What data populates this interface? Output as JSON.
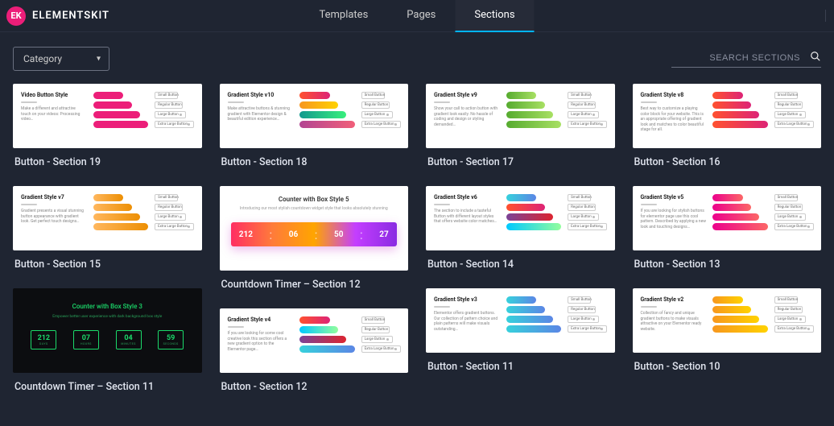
{
  "header": {
    "brand": "ELEMENTSKIT",
    "logo_initials": "EK",
    "tabs": [
      {
        "label": "Templates",
        "active": false
      },
      {
        "label": "Pages",
        "active": false
      },
      {
        "label": "Sections",
        "active": true
      }
    ]
  },
  "subbar": {
    "category_label": "Category",
    "search_placeholder": "SEARCH SECTIONS"
  },
  "cards": [
    {
      "title": "Button - Section 19",
      "ptitle": "Video Button Style",
      "psub": "Make a different and attractive touch on your videos: Processing video…",
      "labels": [
        "Small Button",
        "Regular Button",
        "Large Button",
        "Extra Large Button"
      ],
      "pills": [
        "#ec1e79",
        "#ec1e79",
        "#ec1e79",
        "#ec1e79"
      ],
      "h": 80
    },
    {
      "title": "Button - Section 15",
      "ptitle": "Gradient Style v7",
      "psub": "Gradient presents a visual stunning button appearance with gradient look. Get perfect touch designs…",
      "labels": [
        "Small Button",
        "Regular Button",
        "Large Button",
        "Extra Large Button"
      ],
      "pills": [
        "linear-gradient(90deg,#ffb75e,#ed8f03)",
        "linear-gradient(90deg,#ffb75e,#ed8f03)",
        "linear-gradient(90deg,#ffb75e,#ed8f03)",
        "linear-gradient(90deg,#ffb75e,#ed8f03)"
      ],
      "h": 80
    },
    {
      "title": "Countdown Timer – Section 11",
      "type": "cd11",
      "ptitle": "Counter with Box Style 3",
      "psub": "Empower better user experience with dark background box style",
      "nums": [
        "212",
        "07",
        "04",
        "59"
      ],
      "units": [
        "DAYS",
        "HOURS",
        "MINUTES",
        "SECONDS"
      ],
      "h": 105
    },
    {
      "title": "Button - Section 18",
      "ptitle": "Gradient Style v10",
      "psub": "Make attractive buttons & stunning gradient with Elementor design & beautiful edition experience…",
      "labels": [
        "Small Button",
        "Regular Button",
        "Large Button",
        "Extra Large Button"
      ],
      "pills": [
        "linear-gradient(90deg,#ff512f,#dd2476)",
        "linear-gradient(90deg,#f7971e,#ffd200)",
        "linear-gradient(90deg,#11998e,#38ef7d)",
        "linear-gradient(90deg,#b24592,#f15f79)"
      ],
      "h": 80
    },
    {
      "title": "Countdown Timer – Section 12",
      "type": "cd12",
      "ptitle": "Counter with Box Style 5",
      "psub": "Introducing our most stylish countdown widget style that looks absolutely stunning",
      "nums": [
        "212",
        "06",
        "50",
        "27"
      ],
      "h": 105
    },
    {
      "title": "Button - Section 12",
      "ptitle": "Gradient Style v4",
      "psub": "If you are looking for some cool creative look this section offers a new gradient option to the Elementor page…",
      "labels": [
        "Small Button",
        "Regular Button",
        "Large Button",
        "Extra Large Button"
      ],
      "pills": [
        "linear-gradient(90deg,#ff512f,#dd2476)",
        "linear-gradient(90deg,#00c9ff,#92fe9d)",
        "linear-gradient(90deg,#7b4397,#dc2430)",
        "linear-gradient(90deg,#36d1dc,#5b86e5)"
      ],
      "h": 80
    },
    {
      "title": "Button - Section 17",
      "ptitle": "Gradient Style v9",
      "psub": "Show your call to action button with gradient look easily. No hassle of coding and design or styling demanded…",
      "labels": [
        "Small Button",
        "Regular Button",
        "Large Button",
        "Extra Large Button"
      ],
      "pills": [
        "linear-gradient(90deg,#56ab2f,#a8e063)",
        "linear-gradient(90deg,#56ab2f,#a8e063)",
        "linear-gradient(90deg,#56ab2f,#a8e063)",
        "linear-gradient(90deg,#56ab2f,#a8e063)"
      ],
      "h": 80
    },
    {
      "title": "Button - Section 14",
      "ptitle": "Gradient Style v6",
      "psub": "The section to include a tasteful Button with different layout styles that offers website color matches…",
      "labels": [
        "Small Button",
        "Regular Button",
        "Large Button",
        "Extra Large Button"
      ],
      "pills": [
        "linear-gradient(90deg,#36d1dc,#5b86e5)",
        "linear-gradient(90deg,#ff512f,#dd2476)",
        "linear-gradient(90deg,#7b4397,#dc2430)",
        "linear-gradient(90deg,#00c9ff,#92fe9d)"
      ],
      "h": 80
    },
    {
      "title": "Button - Section 11",
      "ptitle": "Gradient Style v3",
      "psub": "Elementor offers gradient buttons. Our collection of pattern choice and plain patterns will make visuals outstanding…",
      "labels": [
        "Small Button",
        "Regular Button",
        "Large Button",
        "Extra Large Button"
      ],
      "pills": [
        "linear-gradient(90deg,#36d1dc,#5b86e5)",
        "linear-gradient(90deg,#36d1dc,#5b86e5)",
        "linear-gradient(90deg,#36d1dc,#5b86e5)",
        "linear-gradient(90deg,#36d1dc,#5b86e5)"
      ],
      "h": 80
    },
    {
      "title": "Button - Section 16",
      "ptitle": "Gradient Style v8",
      "psub": "Best way to customize a playing color block for your website. This is an appropriate offering of gradient look and matches to color beautiful stage for all.",
      "labels": [
        "Small Button",
        "Regular Button",
        "Large Button",
        "Extra Large Button"
      ],
      "pills": [
        "linear-gradient(90deg,#ff512f,#dd2476)",
        "linear-gradient(90deg,#ff512f,#dd2476)",
        "linear-gradient(90deg,#ff512f,#dd2476)",
        "linear-gradient(90deg,#ff512f,#dd2476)"
      ],
      "h": 80
    },
    {
      "title": "Button - Section 13",
      "ptitle": "Gradient Style v5",
      "psub": "If you are looking for stylish buttons for elementor page use this cool pattern. Described by applying a new look and touching designs…",
      "labels": [
        "Small Button",
        "Regular Button",
        "Large Button",
        "Extra Large Button"
      ],
      "pills": [
        "linear-gradient(90deg,#ec008c,#fc6767)",
        "linear-gradient(90deg,#ec008c,#fc6767)",
        "linear-gradient(90deg,#ec008c,#fc6767)",
        "linear-gradient(90deg,#ec008c,#fc6767)"
      ],
      "h": 80
    },
    {
      "title": "Button - Section 10",
      "ptitle": "Gradient Style v2",
      "psub": "Collection of fancy and unique gradient buttons to make visuals attractive on your Elementor ready website.",
      "labels": [
        "Small Button",
        "Regular Button",
        "Large Button",
        "Extra Large Button"
      ],
      "pills": [
        "linear-gradient(90deg,#f7971e,#ffd200)",
        "linear-gradient(90deg,#f7971e,#ffd200)",
        "linear-gradient(90deg,#f7971e,#ffd200)",
        "linear-gradient(90deg,#f7971e,#ffd200)"
      ],
      "h": 80
    }
  ]
}
